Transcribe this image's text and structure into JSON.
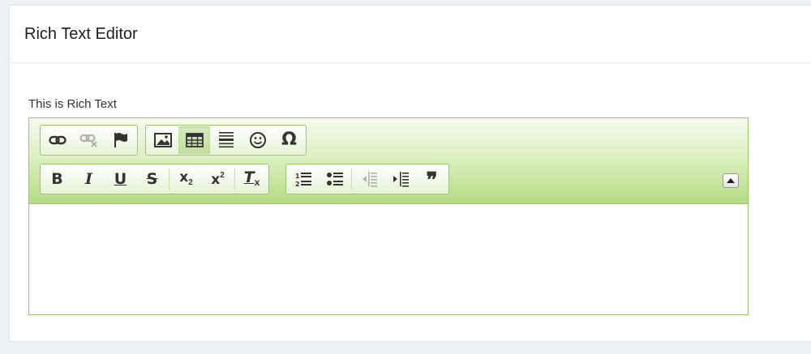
{
  "page": {
    "title": "Rich Text Editor"
  },
  "field": {
    "label": "This is Rich Text"
  },
  "toolbar": {
    "accent": "#9ac46a",
    "row1": [
      {
        "group": "links",
        "buttons": [
          {
            "name": "link-icon",
            "state": "normal"
          },
          {
            "name": "unlink-icon",
            "state": "disabled"
          },
          {
            "name": "anchor-flag-icon",
            "state": "normal"
          }
        ]
      },
      {
        "group": "insert",
        "buttons": [
          {
            "name": "image-icon",
            "state": "normal"
          },
          {
            "name": "table-icon",
            "state": "active"
          },
          {
            "name": "horizontal-rule-icon",
            "state": "normal"
          },
          {
            "name": "smiley-icon",
            "state": "normal"
          },
          {
            "name": "special-char-omega-icon",
            "state": "normal",
            "glyph": "Ω"
          }
        ]
      }
    ],
    "row2": [
      {
        "group": "basicstyles",
        "buttons": [
          {
            "name": "bold-icon",
            "glyph": "B"
          },
          {
            "name": "italic-icon",
            "glyph": "I"
          },
          {
            "name": "underline-icon",
            "glyph": "U"
          },
          {
            "name": "strikethrough-icon",
            "glyph": "S"
          },
          {
            "name": "subscript-icon",
            "glyph": "x",
            "sub": "2"
          },
          {
            "name": "superscript-icon",
            "glyph": "x",
            "sup": "2"
          },
          {
            "name": "remove-format-icon",
            "glyph": "T",
            "sub": "x"
          }
        ]
      },
      {
        "group": "paragraph",
        "buttons": [
          {
            "name": "numbered-list-icon",
            "state": "normal"
          },
          {
            "name": "bulleted-list-icon",
            "state": "normal"
          },
          {
            "name": "decrease-indent-icon",
            "state": "disabled"
          },
          {
            "name": "increase-indent-icon",
            "state": "normal"
          },
          {
            "name": "blockquote-icon",
            "state": "normal",
            "glyph": "❞"
          }
        ]
      }
    ]
  },
  "collapse": {
    "icon": "triangle-up-icon"
  },
  "content": {
    "value": ""
  }
}
